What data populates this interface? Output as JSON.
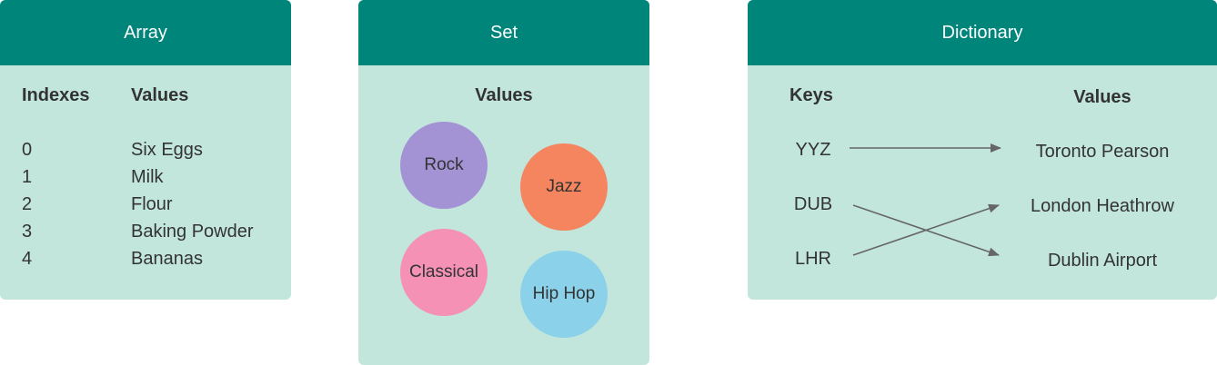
{
  "array": {
    "title": "Array",
    "index_header": "Indexes",
    "value_header": "Values",
    "rows": [
      {
        "index": "0",
        "value": "Six Eggs"
      },
      {
        "index": "1",
        "value": "Milk"
      },
      {
        "index": "2",
        "value": "Flour"
      },
      {
        "index": "3",
        "value": "Baking Powder"
      },
      {
        "index": "4",
        "value": "Bananas"
      }
    ]
  },
  "set": {
    "title": "Set",
    "value_header": "Values",
    "items": [
      {
        "label": "Rock",
        "color": "#a393d5"
      },
      {
        "label": "Jazz",
        "color": "#f5855f"
      },
      {
        "label": "Classical",
        "color": "#f491b5"
      },
      {
        "label": "Hip Hop",
        "color": "#8bd1ea"
      }
    ]
  },
  "dictionary": {
    "title": "Dictionary",
    "key_header": "Keys",
    "value_header": "Values",
    "keys": [
      "YYZ",
      "DUB",
      "LHR"
    ],
    "values": [
      "Toronto Pearson",
      "London Heathrow",
      "Dublin Airport"
    ],
    "mapping": [
      {
        "key": "YYZ",
        "value": "Toronto Pearson"
      },
      {
        "key": "DUB",
        "value": "Dublin Airport"
      },
      {
        "key": "LHR",
        "value": "London Heathrow"
      }
    ]
  },
  "colors": {
    "header": "#00857b",
    "panel": "#c2e6dc",
    "arrow": "#666666"
  }
}
